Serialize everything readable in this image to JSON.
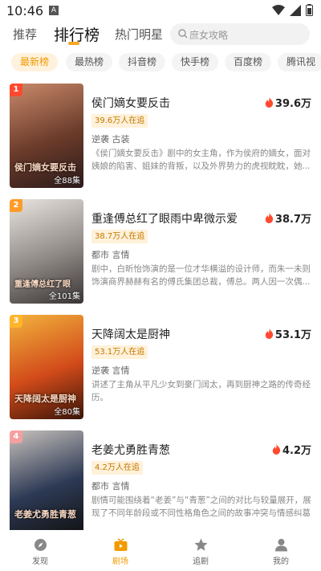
{
  "status_bar": {
    "time": "10:46",
    "notification_letter": "A"
  },
  "top_tabs": [
    {
      "label": "推荐"
    },
    {
      "label": "排行榜"
    },
    {
      "label": "热门明星"
    }
  ],
  "search": {
    "placeholder": "庶女攻略"
  },
  "categories": [
    {
      "label": "最新榜",
      "active": true
    },
    {
      "label": "最热榜"
    },
    {
      "label": "抖音榜"
    },
    {
      "label": "快手榜"
    },
    {
      "label": "百度榜"
    },
    {
      "label": "腾讯视"
    }
  ],
  "dramas": [
    {
      "rank": "1",
      "rank_color": "#ff4a2f",
      "title": "侯门嫡女要反击",
      "heat": "39.6万",
      "watching": "39.6万人在追",
      "tags": "逆袭 古装",
      "desc": "《侯门嫡女要反击》剧中的女主角，作为侯府的嫡女，面对姨娘的陷害、姐妹的背叛，以及外界势力的虎视眈眈，她...",
      "episodes": "全88集",
      "poster_text": "侯门嫡女要反击",
      "poster_colors": [
        "#6b3b2a",
        "#c98a6b",
        "#2a1a1a"
      ]
    },
    {
      "rank": "2",
      "rank_color": "#ff9b2a",
      "title": "重逢傅总红了眼雨中卑微示爱",
      "heat": "38.7万",
      "watching": "38.7万人在追",
      "tags": "都市 言情",
      "desc": "剧中，白昕怡饰演的是一位才华横溢的设计师，而朱一未则饰演商界赫赫有名的傅氏集团总裁，傅总。两人因一次偶...",
      "episodes": "全101集",
      "poster_text": "重逢傅总红了眼",
      "poster_colors": [
        "#d9d4cf",
        "#8f8a86",
        "#3a3535"
      ]
    },
    {
      "rank": "3",
      "rank_color": "#ffb52a",
      "title": "天降阔太是厨神",
      "heat": "53.1万",
      "watching": "53.1万人在追",
      "tags": "逆袭 言情",
      "desc": "讲述了主角从平凡少女到豪门阔太，再到厨神之路的传奇经历。",
      "episodes": "全80集",
      "poster_text": "天降阔太是厨神",
      "poster_colors": [
        "#d24b1a",
        "#f2b33d",
        "#3a1408"
      ]
    },
    {
      "rank": "4",
      "rank_color": "#f5a0a0",
      "title": "老姜尤勇胜青葱",
      "heat": "4.2万",
      "watching": "4.2万人在追",
      "tags": "都市 言情",
      "desc": "剧情可能围绕着“老姜”与“青葱”之间的对比与较量展开，展现了不同年龄段或不同性格角色之间的故事冲突与情感纠葛",
      "episodes": "",
      "poster_text": "老姜尤勇胜青葱",
      "poster_colors": [
        "#2d3a55",
        "#c9c2bd",
        "#111"
      ]
    }
  ],
  "bottom_nav": [
    {
      "label": "发现",
      "icon": "compass-icon"
    },
    {
      "label": "剧场",
      "icon": "tv-play-icon",
      "active": true
    },
    {
      "label": "追剧",
      "icon": "star-icon"
    },
    {
      "label": "我的",
      "icon": "person-icon"
    }
  ],
  "colors": {
    "accent": "#f29a00",
    "heat_flame": "#ff4a2f"
  }
}
